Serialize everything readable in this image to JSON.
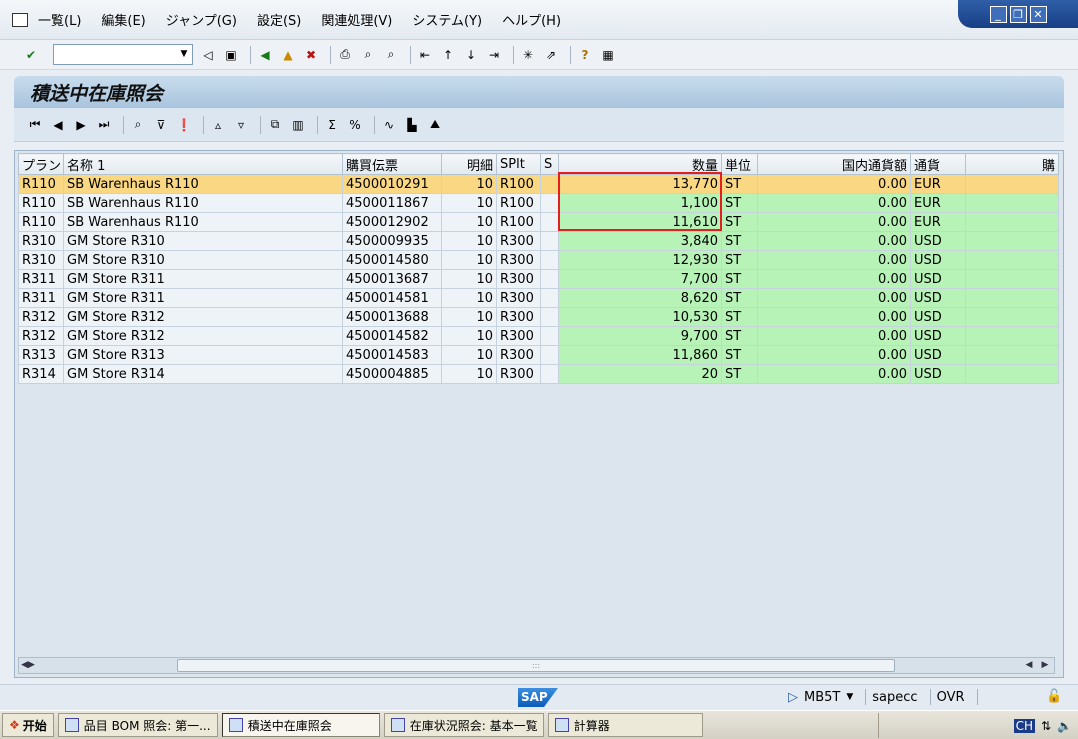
{
  "menu": {
    "items": [
      "一覧(L)",
      "編集(E)",
      "ジャンプ(G)",
      "設定(S)",
      "関連処理(V)",
      "システム(Y)",
      "ヘルプ(H)"
    ]
  },
  "window_controls": [
    "minimize",
    "restore",
    "close"
  ],
  "command_field": {
    "value": "",
    "placeholder": ""
  },
  "title": "積送中在庫照会",
  "grid": {
    "columns": [
      "プラン",
      "名称 1",
      "購買伝票",
      "明細",
      "SPlt",
      "S",
      "数量",
      "単位",
      "国内通貨額",
      "通貨",
      "購"
    ],
    "rows": [
      [
        "R110",
        "SB Warenhaus R110",
        "4500010291",
        "10",
        "R100",
        "",
        "13,770",
        "ST",
        "0.00",
        "EUR",
        ""
      ],
      [
        "R110",
        "SB Warenhaus R110",
        "4500011867",
        "10",
        "R100",
        "",
        "1,100",
        "ST",
        "0.00",
        "EUR",
        ""
      ],
      [
        "R110",
        "SB Warenhaus R110",
        "4500012902",
        "10",
        "R100",
        "",
        "11,610",
        "ST",
        "0.00",
        "EUR",
        ""
      ],
      [
        "R310",
        "GM Store R310",
        "4500009935",
        "10",
        "R300",
        "",
        "3,840",
        "ST",
        "0.00",
        "USD",
        ""
      ],
      [
        "R310",
        "GM Store R310",
        "4500014580",
        "10",
        "R300",
        "",
        "12,930",
        "ST",
        "0.00",
        "USD",
        ""
      ],
      [
        "R311",
        "GM Store R311",
        "4500013687",
        "10",
        "R300",
        "",
        "7,700",
        "ST",
        "0.00",
        "USD",
        ""
      ],
      [
        "R311",
        "GM Store R311",
        "4500014581",
        "10",
        "R300",
        "",
        "8,620",
        "ST",
        "0.00",
        "USD",
        ""
      ],
      [
        "R312",
        "GM Store R312",
        "4500013688",
        "10",
        "R300",
        "",
        "10,530",
        "ST",
        "0.00",
        "USD",
        ""
      ],
      [
        "R312",
        "GM Store R312",
        "4500014582",
        "10",
        "R300",
        "",
        "9,700",
        "ST",
        "0.00",
        "USD",
        ""
      ],
      [
        "R313",
        "GM Store R313",
        "4500014583",
        "10",
        "R300",
        "",
        "11,860",
        "ST",
        "0.00",
        "USD",
        ""
      ],
      [
        "R314",
        "GM Store R314",
        "4500004885",
        "10",
        "R300",
        "",
        "20",
        "ST",
        "0.00",
        "USD",
        ""
      ]
    ],
    "selected_row": 0
  },
  "status": {
    "sap_logo": "SAP",
    "transaction": "MB5T",
    "server": "sapecc",
    "mode": "OVR"
  },
  "taskbar": {
    "start": "开始",
    "tasks": [
      "品目 BOM 照会: 第一...",
      "積送中在庫照会",
      "在庫状況照会: 基本一覧",
      "計算器"
    ],
    "active_task": 1,
    "tray_text": "CH"
  },
  "colors": {
    "selected_row": "#f9d783",
    "quantity_bg": "#b7f2b7",
    "highlight_box": "#e41e1e"
  }
}
